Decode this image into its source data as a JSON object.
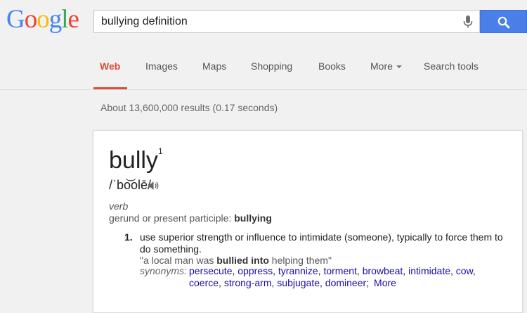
{
  "logo": {
    "letters": [
      {
        "ch": "G",
        "color": "#4285f4"
      },
      {
        "ch": "o",
        "color": "#ea4335"
      },
      {
        "ch": "o",
        "color": "#fbbc05"
      },
      {
        "ch": "g",
        "color": "#4285f4"
      },
      {
        "ch": "l",
        "color": "#34a853"
      },
      {
        "ch": "e",
        "color": "#ea4335"
      }
    ]
  },
  "search": {
    "value": "bullying definition",
    "mic_icon": "microphone-icon",
    "button_icon": "search-icon"
  },
  "nav": {
    "items": [
      "Web",
      "Images",
      "Maps",
      "Shopping",
      "Books",
      "More",
      "Search tools"
    ],
    "active": "Web"
  },
  "results": {
    "count_text": "About 13,600,000 results (0.17 seconds)"
  },
  "definition": {
    "word": "bully",
    "superscript": "1",
    "pronunciation": "/ˈbo͝olē/",
    "speaker_icon": "speaker-icon",
    "part_of_speech": "verb",
    "gerund_label": "gerund or present participle: ",
    "gerund_word": "bullying",
    "number": "1.",
    "text": "use superior strength or influence to intimidate (someone), typically to force them to do something.",
    "example_prefix": "\"a local man was ",
    "example_bold": "bullied into",
    "example_suffix": " helping them\"",
    "synonyms_label": "synonyms:",
    "synonyms": [
      "persecute",
      "oppress",
      "tyrannize",
      "torment",
      "browbeat",
      "intimidate",
      "cow",
      "coerce",
      "strong-arm",
      "subjugate",
      "domineer"
    ],
    "more_label": "More",
    "link_color": "#1a0dab"
  }
}
